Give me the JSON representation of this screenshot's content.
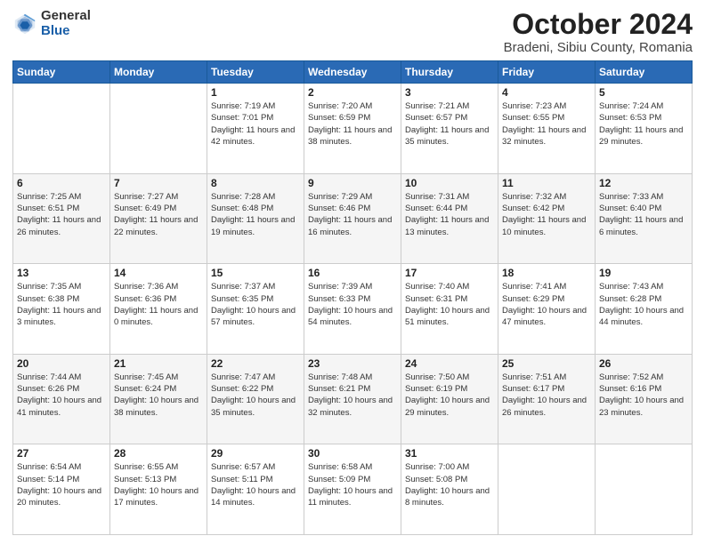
{
  "logo": {
    "general": "General",
    "blue": "Blue"
  },
  "header": {
    "title": "October 2024",
    "subtitle": "Bradeni, Sibiu County, Romania"
  },
  "days_of_week": [
    "Sunday",
    "Monday",
    "Tuesday",
    "Wednesday",
    "Thursday",
    "Friday",
    "Saturday"
  ],
  "weeks": [
    [
      {
        "num": "",
        "text": ""
      },
      {
        "num": "",
        "text": ""
      },
      {
        "num": "1",
        "text": "Sunrise: 7:19 AM\nSunset: 7:01 PM\nDaylight: 11 hours and 42 minutes."
      },
      {
        "num": "2",
        "text": "Sunrise: 7:20 AM\nSunset: 6:59 PM\nDaylight: 11 hours and 38 minutes."
      },
      {
        "num": "3",
        "text": "Sunrise: 7:21 AM\nSunset: 6:57 PM\nDaylight: 11 hours and 35 minutes."
      },
      {
        "num": "4",
        "text": "Sunrise: 7:23 AM\nSunset: 6:55 PM\nDaylight: 11 hours and 32 minutes."
      },
      {
        "num": "5",
        "text": "Sunrise: 7:24 AM\nSunset: 6:53 PM\nDaylight: 11 hours and 29 minutes."
      }
    ],
    [
      {
        "num": "6",
        "text": "Sunrise: 7:25 AM\nSunset: 6:51 PM\nDaylight: 11 hours and 26 minutes."
      },
      {
        "num": "7",
        "text": "Sunrise: 7:27 AM\nSunset: 6:49 PM\nDaylight: 11 hours and 22 minutes."
      },
      {
        "num": "8",
        "text": "Sunrise: 7:28 AM\nSunset: 6:48 PM\nDaylight: 11 hours and 19 minutes."
      },
      {
        "num": "9",
        "text": "Sunrise: 7:29 AM\nSunset: 6:46 PM\nDaylight: 11 hours and 16 minutes."
      },
      {
        "num": "10",
        "text": "Sunrise: 7:31 AM\nSunset: 6:44 PM\nDaylight: 11 hours and 13 minutes."
      },
      {
        "num": "11",
        "text": "Sunrise: 7:32 AM\nSunset: 6:42 PM\nDaylight: 11 hours and 10 minutes."
      },
      {
        "num": "12",
        "text": "Sunrise: 7:33 AM\nSunset: 6:40 PM\nDaylight: 11 hours and 6 minutes."
      }
    ],
    [
      {
        "num": "13",
        "text": "Sunrise: 7:35 AM\nSunset: 6:38 PM\nDaylight: 11 hours and 3 minutes."
      },
      {
        "num": "14",
        "text": "Sunrise: 7:36 AM\nSunset: 6:36 PM\nDaylight: 11 hours and 0 minutes."
      },
      {
        "num": "15",
        "text": "Sunrise: 7:37 AM\nSunset: 6:35 PM\nDaylight: 10 hours and 57 minutes."
      },
      {
        "num": "16",
        "text": "Sunrise: 7:39 AM\nSunset: 6:33 PM\nDaylight: 10 hours and 54 minutes."
      },
      {
        "num": "17",
        "text": "Sunrise: 7:40 AM\nSunset: 6:31 PM\nDaylight: 10 hours and 51 minutes."
      },
      {
        "num": "18",
        "text": "Sunrise: 7:41 AM\nSunset: 6:29 PM\nDaylight: 10 hours and 47 minutes."
      },
      {
        "num": "19",
        "text": "Sunrise: 7:43 AM\nSunset: 6:28 PM\nDaylight: 10 hours and 44 minutes."
      }
    ],
    [
      {
        "num": "20",
        "text": "Sunrise: 7:44 AM\nSunset: 6:26 PM\nDaylight: 10 hours and 41 minutes."
      },
      {
        "num": "21",
        "text": "Sunrise: 7:45 AM\nSunset: 6:24 PM\nDaylight: 10 hours and 38 minutes."
      },
      {
        "num": "22",
        "text": "Sunrise: 7:47 AM\nSunset: 6:22 PM\nDaylight: 10 hours and 35 minutes."
      },
      {
        "num": "23",
        "text": "Sunrise: 7:48 AM\nSunset: 6:21 PM\nDaylight: 10 hours and 32 minutes."
      },
      {
        "num": "24",
        "text": "Sunrise: 7:50 AM\nSunset: 6:19 PM\nDaylight: 10 hours and 29 minutes."
      },
      {
        "num": "25",
        "text": "Sunrise: 7:51 AM\nSunset: 6:17 PM\nDaylight: 10 hours and 26 minutes."
      },
      {
        "num": "26",
        "text": "Sunrise: 7:52 AM\nSunset: 6:16 PM\nDaylight: 10 hours and 23 minutes."
      }
    ],
    [
      {
        "num": "27",
        "text": "Sunrise: 6:54 AM\nSunset: 5:14 PM\nDaylight: 10 hours and 20 minutes."
      },
      {
        "num": "28",
        "text": "Sunrise: 6:55 AM\nSunset: 5:13 PM\nDaylight: 10 hours and 17 minutes."
      },
      {
        "num": "29",
        "text": "Sunrise: 6:57 AM\nSunset: 5:11 PM\nDaylight: 10 hours and 14 minutes."
      },
      {
        "num": "30",
        "text": "Sunrise: 6:58 AM\nSunset: 5:09 PM\nDaylight: 10 hours and 11 minutes."
      },
      {
        "num": "31",
        "text": "Sunrise: 7:00 AM\nSunset: 5:08 PM\nDaylight: 10 hours and 8 minutes."
      },
      {
        "num": "",
        "text": ""
      },
      {
        "num": "",
        "text": ""
      }
    ]
  ]
}
